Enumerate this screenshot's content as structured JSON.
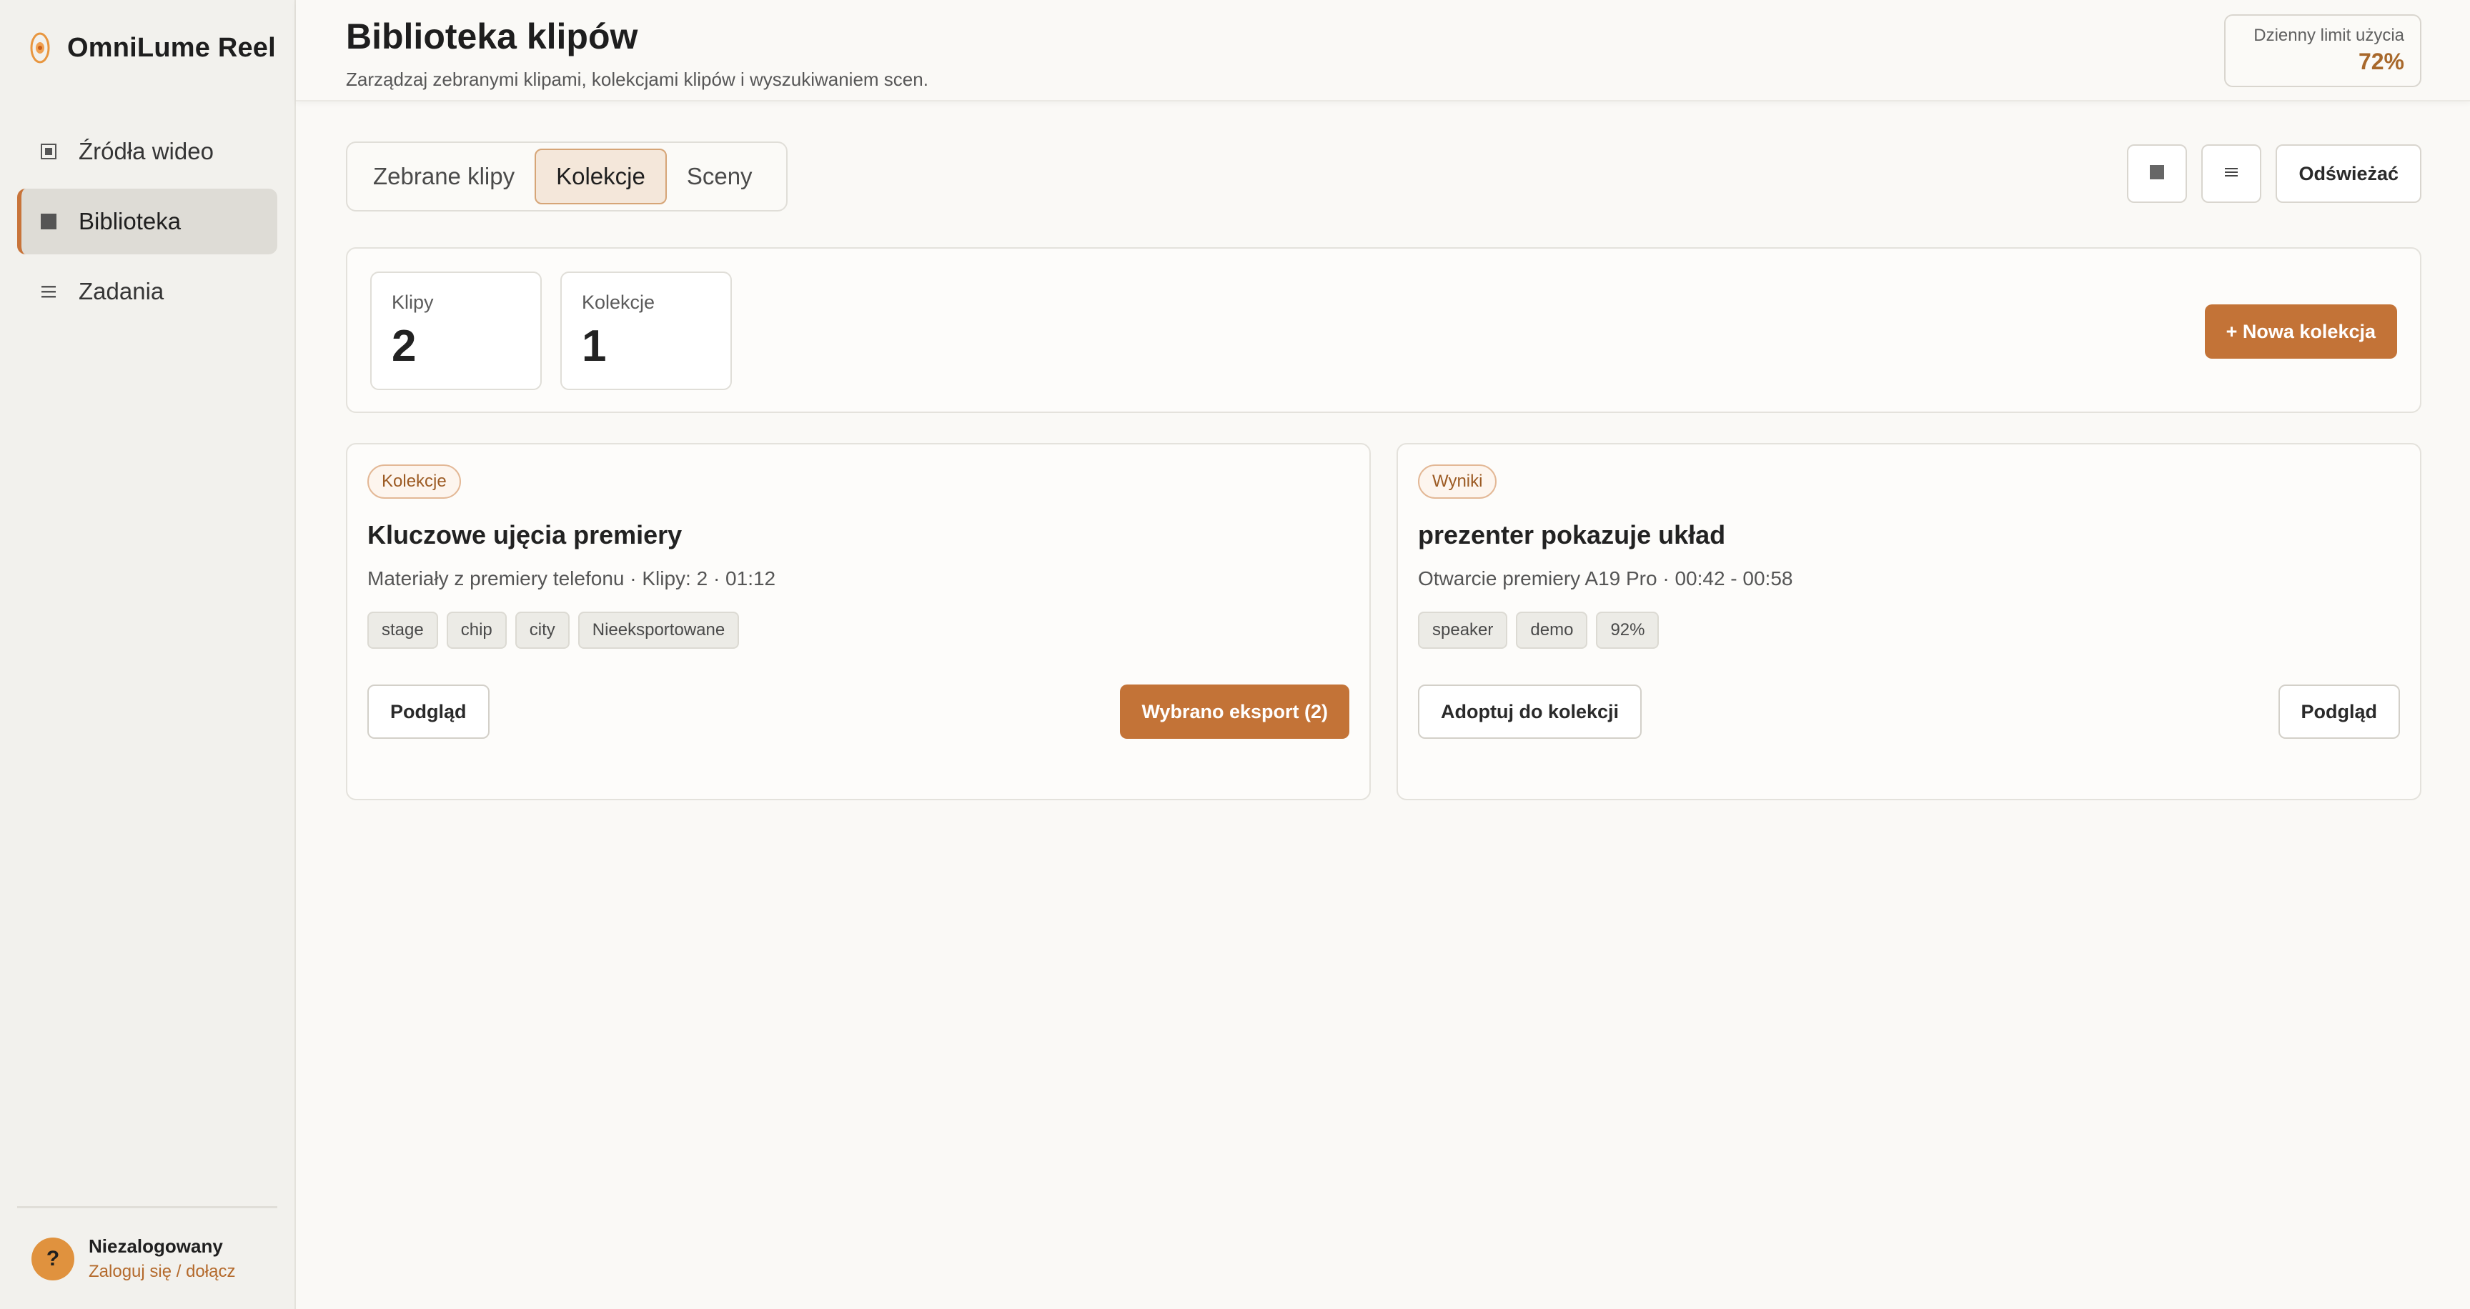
{
  "app": {
    "name": "OmniLume Reel"
  },
  "sidebar": {
    "items": [
      {
        "label": "Źródła wideo",
        "icon": "video-source-icon",
        "active": false
      },
      {
        "label": "Biblioteka",
        "icon": "library-icon",
        "active": true
      },
      {
        "label": "Zadania",
        "icon": "tasks-icon",
        "active": false
      }
    ],
    "footer": {
      "user_status": "Niezalogowany",
      "login_link": "Zaloguj się / dołącz",
      "avatar_glyph": "?"
    }
  },
  "header": {
    "title": "Biblioteka klipów",
    "subtitle": "Zarządzaj zebranymi klipami, kolekcjami klipów i wyszukiwaniem scen.",
    "usage_label": "Dzienny limit użycia",
    "usage_value": "72%"
  },
  "tabs": [
    {
      "label": "Zebrane klipy",
      "active": false
    },
    {
      "label": "Kolekcje",
      "active": true
    },
    {
      "label": "Sceny",
      "active": false
    }
  ],
  "toolbar": {
    "grid_icon": "grid-view-icon",
    "list_icon": "list-view-icon",
    "refresh_label": "Odświeżać"
  },
  "stats": {
    "clips_label": "Klipy",
    "clips_value": "2",
    "collections_label": "Kolekcje",
    "collections_value": "1",
    "new_collection_label": "+ Nowa kolekcja"
  },
  "cards": [
    {
      "badge": "Kolekcje",
      "title": "Kluczowe ujęcia premiery",
      "meta": "Materiały z premiery telefonu · Klipy: 2 · 01:12",
      "tags": [
        "stage",
        "chip",
        "city",
        "Nieeksportowane"
      ],
      "left_action": "Podgląd",
      "right_action": "Wybrano eksport (2)"
    },
    {
      "badge": "Wyniki",
      "title": "prezenter pokazuje układ",
      "meta": "Otwarcie premiery A19 Pro · 00:42 - 00:58",
      "tags": [
        "speaker",
        "demo",
        "92%"
      ],
      "left_action": "Adoptuj do kolekcji",
      "right_action": "Podgląd"
    }
  ],
  "colors": {
    "accent": "#c37337",
    "accent_text": "#a8682b",
    "sidebar_bg": "#f2f1ed",
    "page_bg": "#faf9f6"
  }
}
